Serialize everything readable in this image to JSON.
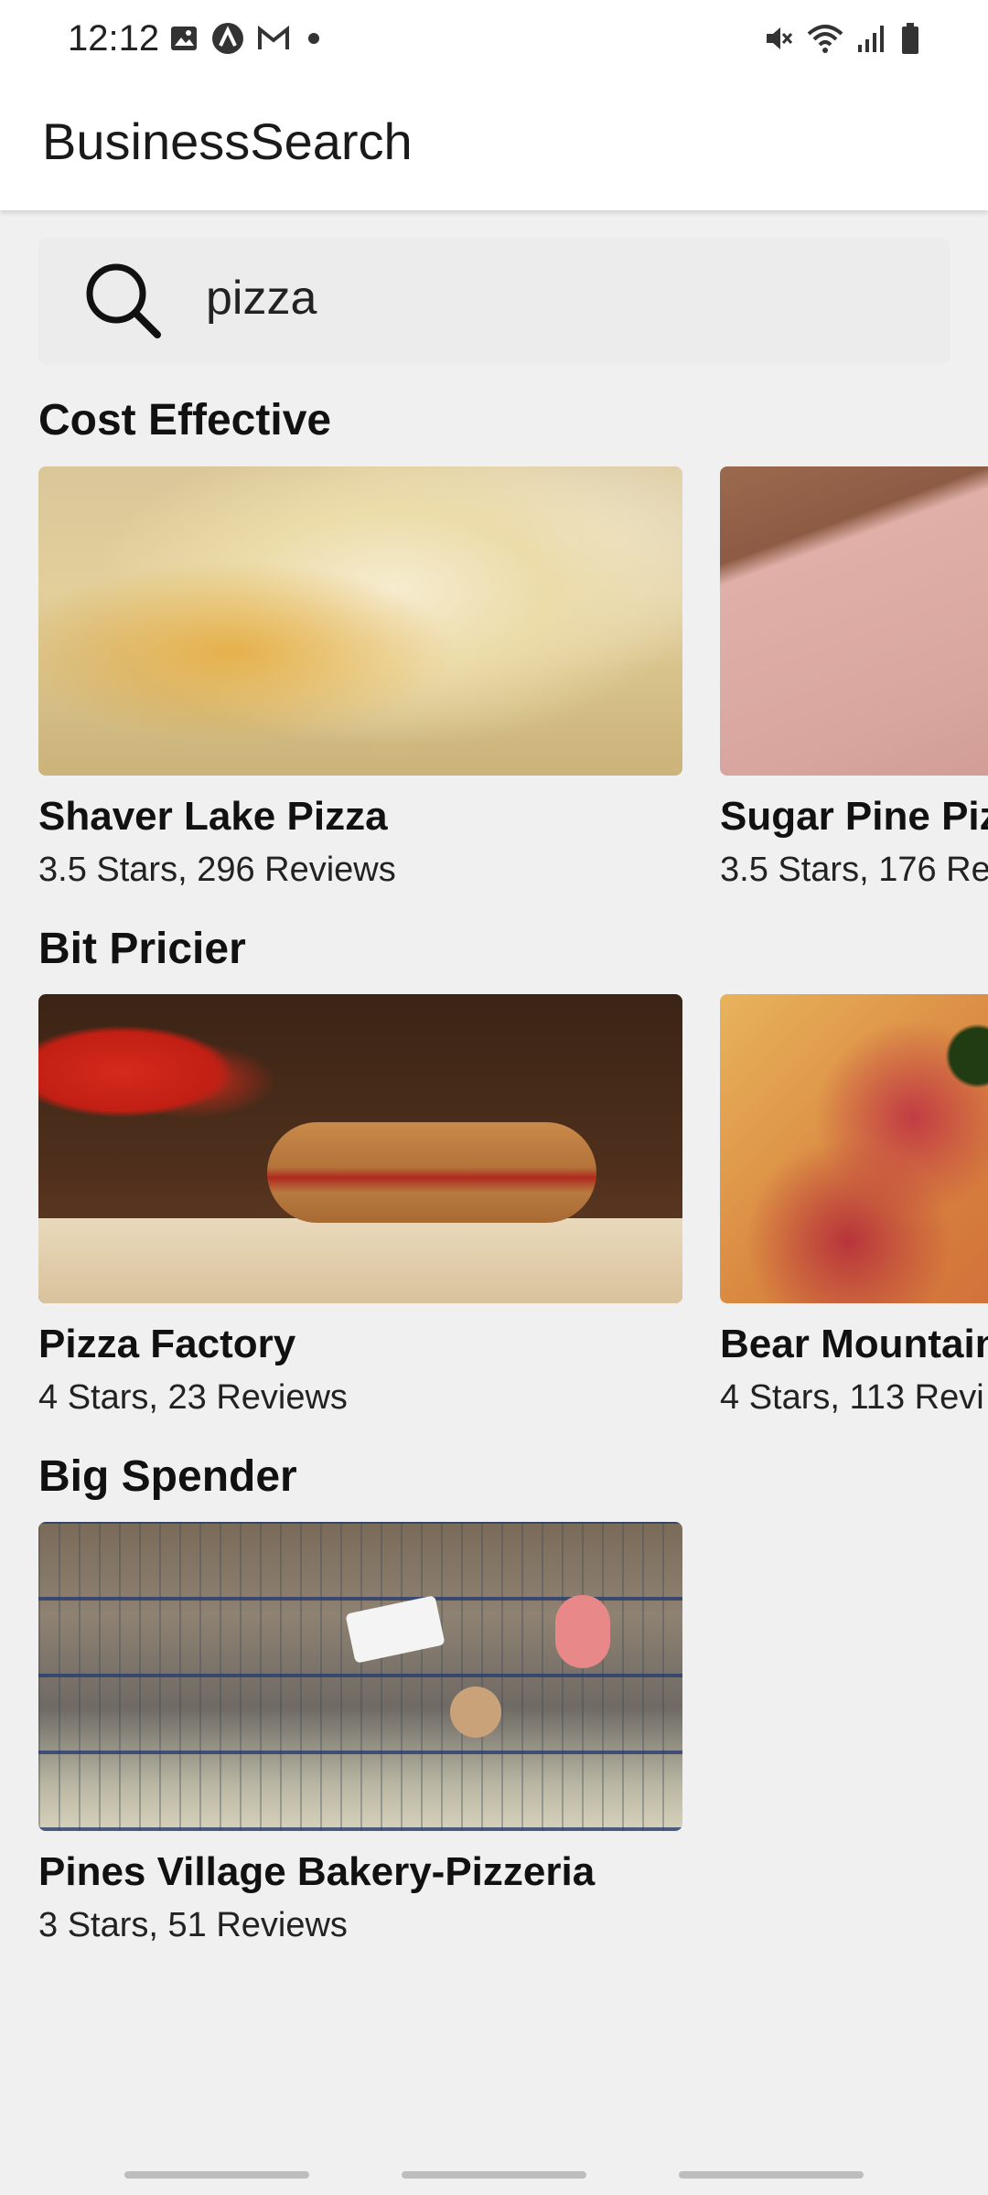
{
  "status_bar": {
    "time": "12:12",
    "left_icons": [
      "image-icon",
      "arc-icon",
      "gmail-icon",
      "dot-icon"
    ],
    "right_icons": [
      "mute-icon",
      "wifi-icon",
      "signal-icon",
      "battery-icon"
    ]
  },
  "app_bar": {
    "title": "BusinessSearch"
  },
  "search": {
    "value": "pizza",
    "icon": "search-icon"
  },
  "sections": [
    {
      "title": "Cost Effective",
      "cards": [
        {
          "name": "Shaver Lake Pizza",
          "rating": "3.5 Stars, 296 Reviews"
        },
        {
          "name": "Sugar Pine Piz",
          "rating": "3.5 Stars, 176 Re"
        }
      ]
    },
    {
      "title": "Bit Pricier",
      "cards": [
        {
          "name": "Pizza Factory",
          "rating": "4 Stars, 23 Reviews"
        },
        {
          "name": "Bear Mountain",
          "rating": "4 Stars, 113 Revi"
        }
      ]
    },
    {
      "title": "Big Spender",
      "cards": [
        {
          "name": "Pines Village Bakery-Pizzeria",
          "rating": "3 Stars, 51 Reviews"
        }
      ]
    }
  ],
  "colors": {
    "background": "#f0f0f0",
    "app_bar": "#ffffff",
    "search_bg": "#ececec"
  }
}
